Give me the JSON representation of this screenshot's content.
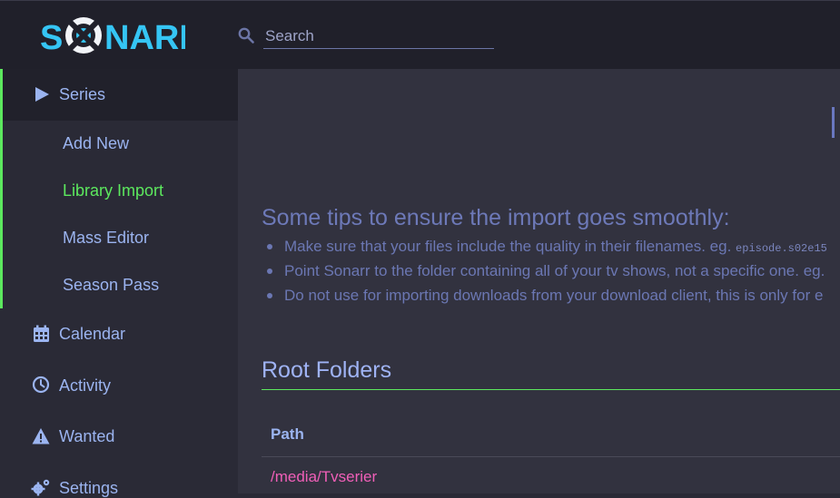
{
  "app": {
    "brand": "SONARR"
  },
  "search": {
    "placeholder": "Search"
  },
  "sidebar": {
    "items": [
      {
        "label": "Series",
        "icon": "play-icon"
      },
      {
        "label": "Calendar",
        "icon": "calendar-icon"
      },
      {
        "label": "Activity",
        "icon": "clock-icon"
      },
      {
        "label": "Wanted",
        "icon": "warning-icon"
      },
      {
        "label": "Settings",
        "icon": "cogs-icon"
      }
    ],
    "series_sub": [
      {
        "label": "Add New"
      },
      {
        "label": "Library Import",
        "active": true
      },
      {
        "label": "Mass Editor"
      },
      {
        "label": "Season Pass"
      }
    ]
  },
  "main": {
    "tips_title": "Some tips to ensure the import goes smoothly:",
    "tips": [
      {
        "text": "Make sure that your files include the quality in their filenames. eg. ",
        "code": "episode.s02e15"
      },
      {
        "text": "Point Sonarr to the folder containing all of your tv shows, not a specific one. eg."
      },
      {
        "text": "Do not use for importing downloads from your download client, this is only for e"
      }
    ],
    "root_folders_title": "Root Folders",
    "table": {
      "column": "Path",
      "rows": [
        {
          "path": "/media/Tvserier"
        }
      ]
    }
  },
  "colors": {
    "accent_green": "#5ce85e",
    "link_blue": "#9bb4f0",
    "path_pink": "#f05fb8",
    "logo_cyan": "#35c5f4"
  }
}
